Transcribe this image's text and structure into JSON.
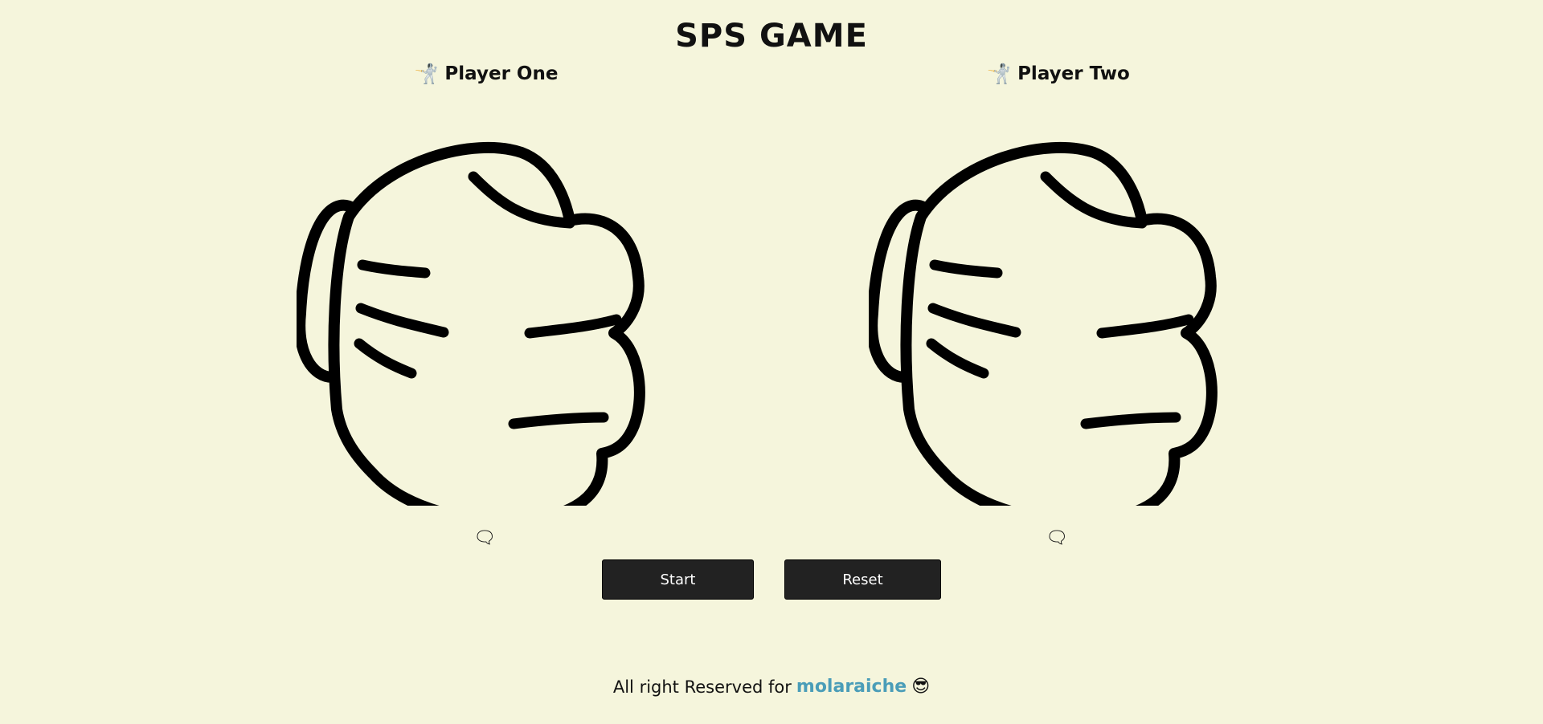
{
  "header": {
    "title": "SPS GAME"
  },
  "players": [
    {
      "icon": "🤺",
      "name": "Player One",
      "choice_icon": "rock-fist-icon",
      "bubble": "🗨"
    },
    {
      "icon": "🤺",
      "name": "Player Two",
      "choice_icon": "rock-fist-icon",
      "bubble": "🗨"
    }
  ],
  "controls": {
    "start_label": "Start",
    "reset_label": "Reset"
  },
  "footer": {
    "text": "All right Reserved for",
    "author": "molaraiche",
    "emoji": "😎"
  }
}
